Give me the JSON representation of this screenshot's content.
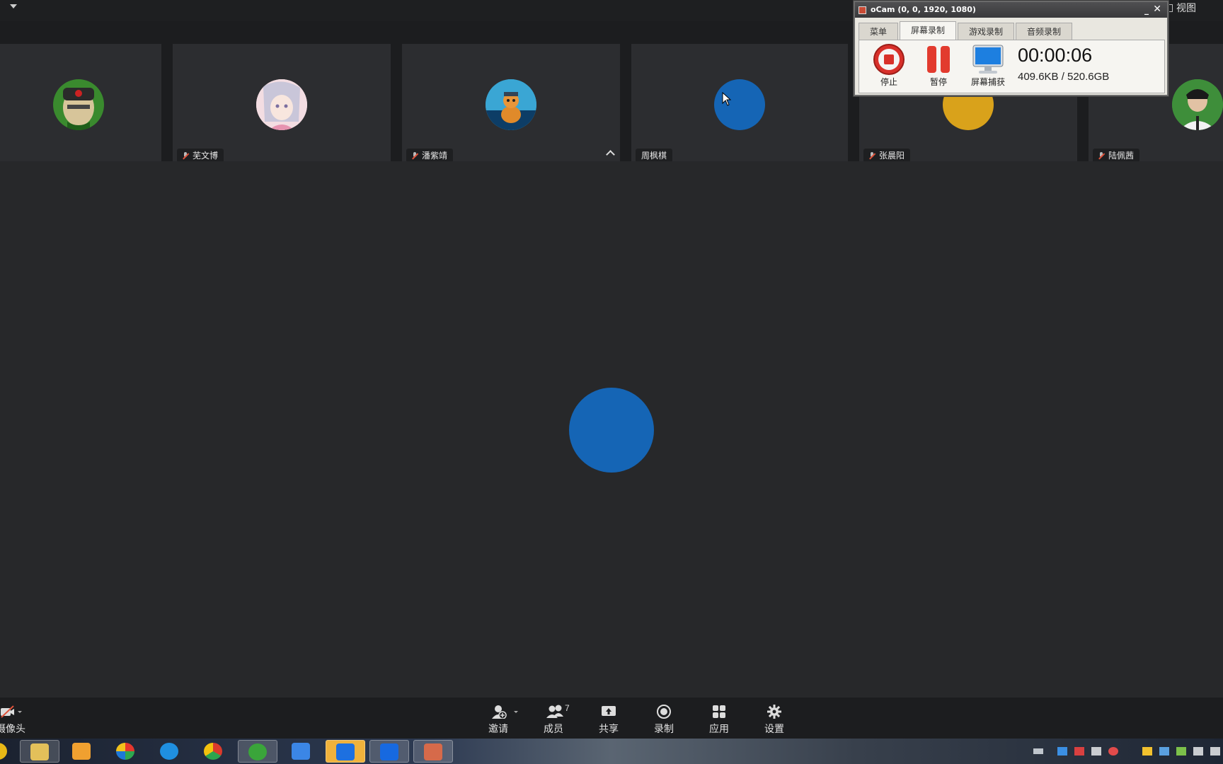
{
  "window": {
    "view_label": "视图"
  },
  "participants": [
    {
      "name": "",
      "mic_muted": true
    },
    {
      "name": "芜文博",
      "mic_muted": true
    },
    {
      "name": "潘紫靖",
      "mic_muted": true
    },
    {
      "name": "周枫棋",
      "mic_muted": false
    },
    {
      "name": "张晨阳",
      "mic_muted": true
    },
    {
      "name": "陆佩茜",
      "mic_muted": true
    }
  ],
  "controls": {
    "camera": "开摄像头",
    "invite": "邀请",
    "members": "成员",
    "member_count": "7",
    "share": "共享",
    "record": "录制",
    "apps": "应用",
    "settings": "设置"
  },
  "ocam": {
    "title": "oCam (0, 0, 1920, 1080)",
    "tabs": [
      "菜单",
      "屏幕录制",
      "游戏录制",
      "音频录制"
    ],
    "active_tab": "屏幕录制",
    "stop": "停止",
    "pause": "暂停",
    "capture": "屏幕捕获",
    "elapsed": "00:00:06",
    "size": "409.6KB / 520.6GB"
  },
  "colors": {
    "avatar_blue": "#1565b5",
    "accent_red": "#e0533b"
  },
  "taskbar": {
    "apps": [
      "file-explorer-icon",
      "media-player-icon",
      "flower-app-icon",
      "browser-icon",
      "chrome-icon",
      "sync-app-icon",
      "bird-app-icon",
      "feishu-icon",
      "meeting-app-icon",
      "ocam-app-icon"
    ]
  }
}
